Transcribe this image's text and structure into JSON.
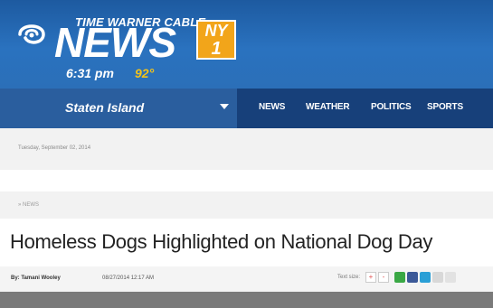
{
  "header": {
    "brand_small": "TIME WARNER CABLE",
    "brand_big": "NEWS",
    "channel_top": "NY",
    "channel_bottom": "1",
    "time": "6:31 pm",
    "temperature": "92°"
  },
  "nav": {
    "local_label": "Staten Island",
    "items": [
      "NEWS",
      "WEATHER",
      "POLITICS",
      "SPORTS"
    ]
  },
  "dateline": "Tuesday, September 02, 2014",
  "breadcrumb": "» NEWS",
  "article": {
    "headline": "Homeless Dogs Highlighted on National Dog Day",
    "author": "By: Tamani Wooley",
    "timestamp": "08/27/2014 12:17 AM",
    "text_size_label": "Text size:",
    "text_size_plus": "+",
    "text_size_minus": "-"
  },
  "icons": {
    "logo": "twc-eye-swoosh-icon",
    "share": [
      "share-green-icon",
      "facebook-icon",
      "twitter-icon",
      "email-icon",
      "print-icon"
    ]
  },
  "colors": {
    "header_blue": "#2a72bf",
    "nav_dark": "#17407a",
    "accent_orange": "#f2a51a",
    "temperature_yellow": "#f2c21a"
  }
}
